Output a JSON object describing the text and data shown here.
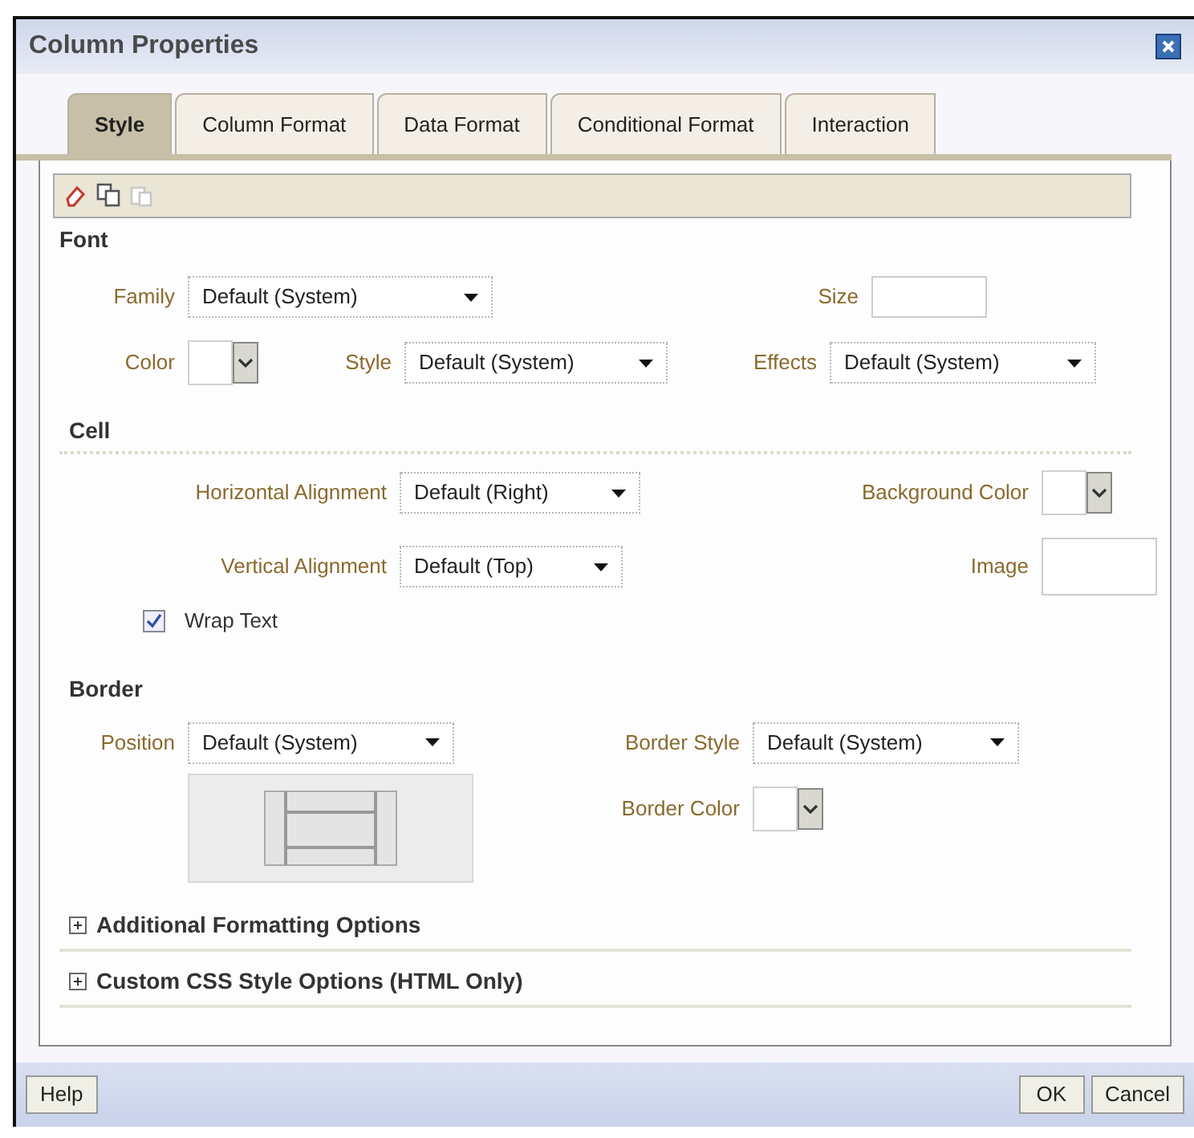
{
  "window": {
    "title": "Column Properties"
  },
  "tabs": [
    {
      "label": "Style",
      "selected": true
    },
    {
      "label": "Column Format",
      "selected": false
    },
    {
      "label": "Data Format",
      "selected": false
    },
    {
      "label": "Conditional Format",
      "selected": false
    },
    {
      "label": "Interaction",
      "selected": false
    }
  ],
  "toolbar": [
    {
      "kind": "eraser",
      "disabled": false
    },
    {
      "kind": "copy",
      "disabled": false
    },
    {
      "kind": "paste",
      "disabled": true
    }
  ],
  "font": {
    "heading": "Font",
    "family": {
      "label": "Family",
      "value": "Default (System)"
    },
    "size": {
      "label": "Size"
    },
    "color": {
      "label": "Color"
    },
    "style": {
      "label": "Style",
      "value": "Default (System)"
    },
    "effects": {
      "label": "Effects",
      "value": "Default (System)"
    }
  },
  "cell": {
    "heading": "Cell",
    "horizontal": {
      "label": "Horizontal Alignment",
      "value": "Default (Right)"
    },
    "background_color": {
      "label": "Background Color"
    },
    "vertical": {
      "label": "Vertical Alignment",
      "value": "Default (Top)"
    },
    "image": {
      "label": "Image"
    },
    "wrap_text": {
      "label": "Wrap Text",
      "checked": true
    }
  },
  "border": {
    "heading": "Border",
    "position": {
      "label": "Position",
      "value": "Default (System)"
    },
    "border_style": {
      "label": "Border Style",
      "value": "Default (System)"
    },
    "border_color": {
      "label": "Border Color"
    }
  },
  "sections": [
    {
      "label": "Additional Formatting Options",
      "expanded": false
    },
    {
      "label": "Custom CSS Style Options (HTML Only)",
      "expanded": false
    }
  ],
  "buttons": {
    "help": "Help",
    "ok": "OK",
    "cancel": "Cancel"
  }
}
